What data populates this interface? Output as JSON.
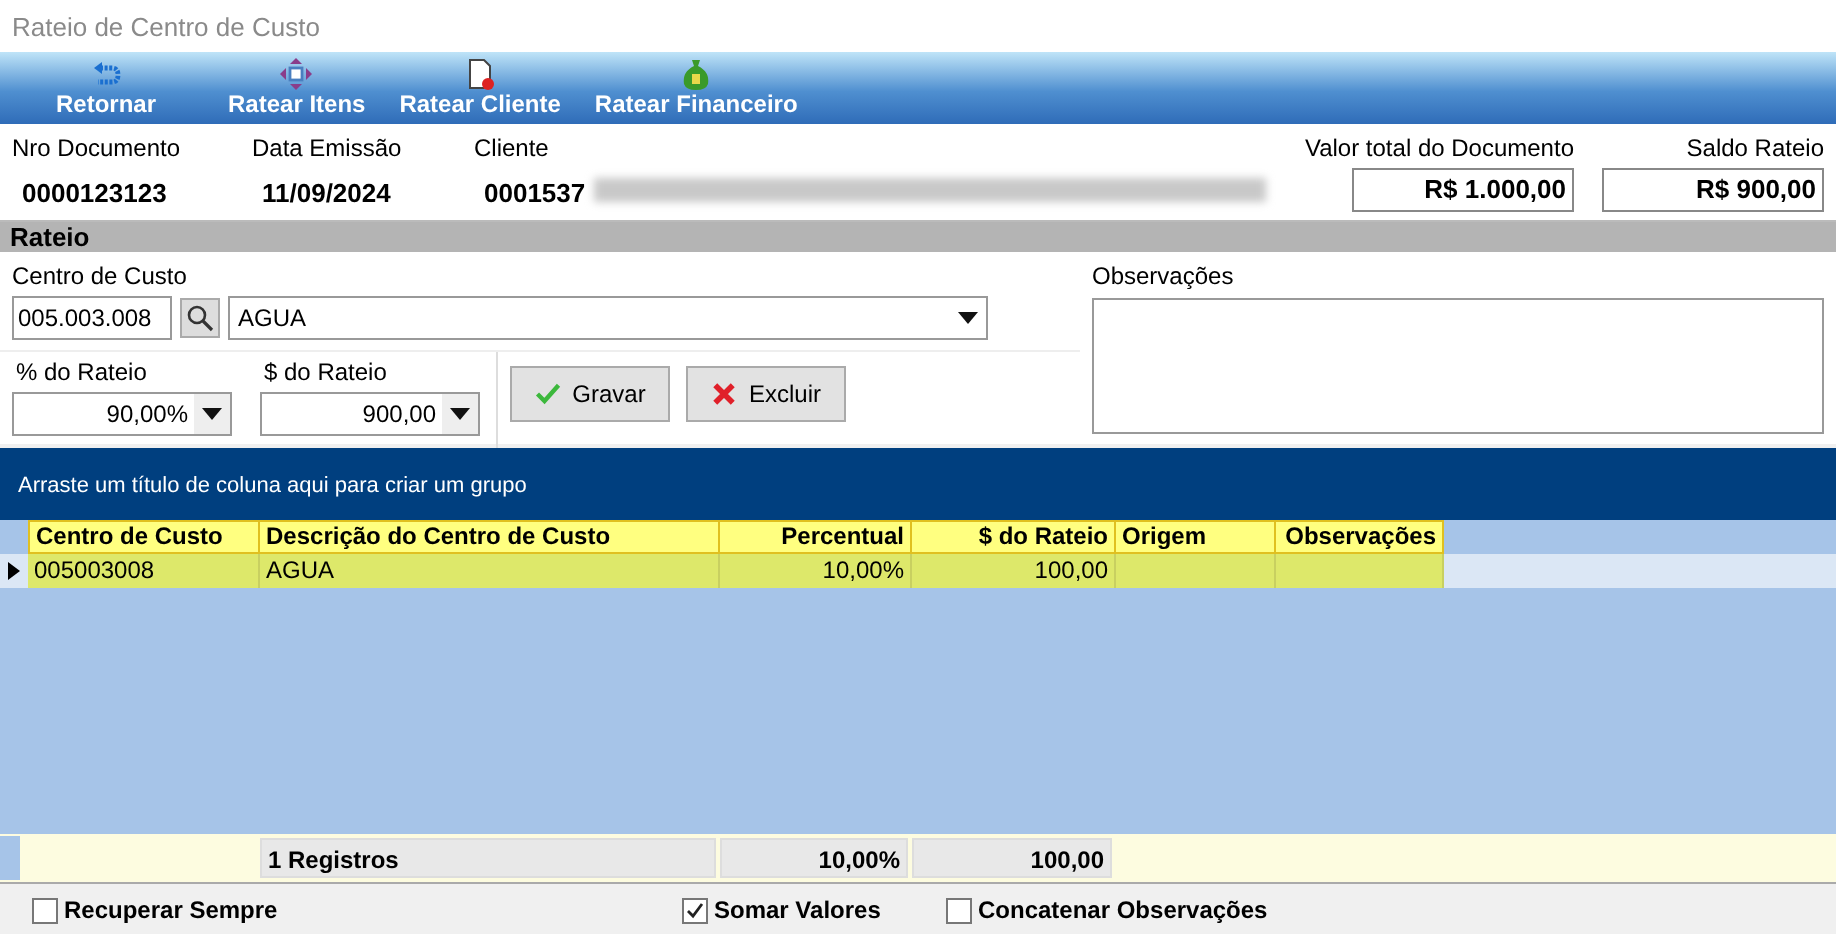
{
  "window": {
    "title": "Rateio de Centro de Custo"
  },
  "toolbar": [
    {
      "label": "Retornar",
      "kind": "return"
    },
    {
      "label": "Ratear Itens",
      "kind": "move"
    },
    {
      "label": "Ratear Cliente",
      "kind": "document"
    },
    {
      "label": "Ratear Financeiro",
      "kind": "money"
    }
  ],
  "header": {
    "fields": [
      {
        "label": "Nro Documento",
        "value": "0000123123"
      },
      {
        "label": "Data Emissão",
        "value": "11/09/2024"
      },
      {
        "label": "Cliente",
        "value": "0001537"
      }
    ],
    "totals": [
      {
        "label": "Valor total do Documento",
        "value": "R$ 1.000,00"
      },
      {
        "label": "Saldo Rateio",
        "value": "R$ 900,00"
      }
    ]
  },
  "rateio": {
    "title": "Rateio",
    "centro_label": "Centro de Custo",
    "centro_code": "005.003.008",
    "centro_desc": "AGUA",
    "percent_label": "% do Rateio",
    "percent_value": "90,00%",
    "amount_label": "$ do Rateio",
    "amount_value": "900,00",
    "notes_label": "Observações",
    "buttons": [
      {
        "label": "Gravar",
        "kind": "save"
      },
      {
        "label": "Excluir",
        "kind": "delete"
      }
    ]
  },
  "grid": {
    "group_hint": "Arraste um título de coluna aqui para criar um grupo",
    "columns": [
      "Centro de Custo",
      "Descrição do Centro de Custo",
      "Percentual",
      "$ do Rateio",
      "Origem",
      "Observações"
    ],
    "rows": [
      {
        "selected": true,
        "cells": [
          "005003008",
          "AGUA",
          "10,00%",
          "100,00"
        ]
      }
    ],
    "footer": [
      "1 Registros",
      "10,00%",
      "100,00"
    ]
  },
  "options": [
    {
      "label": "Recuperar Sempre",
      "checked": false
    },
    {
      "label": "Somar Valores",
      "checked": true
    },
    {
      "label": "Concatenar Observações",
      "checked": false
    }
  ]
}
